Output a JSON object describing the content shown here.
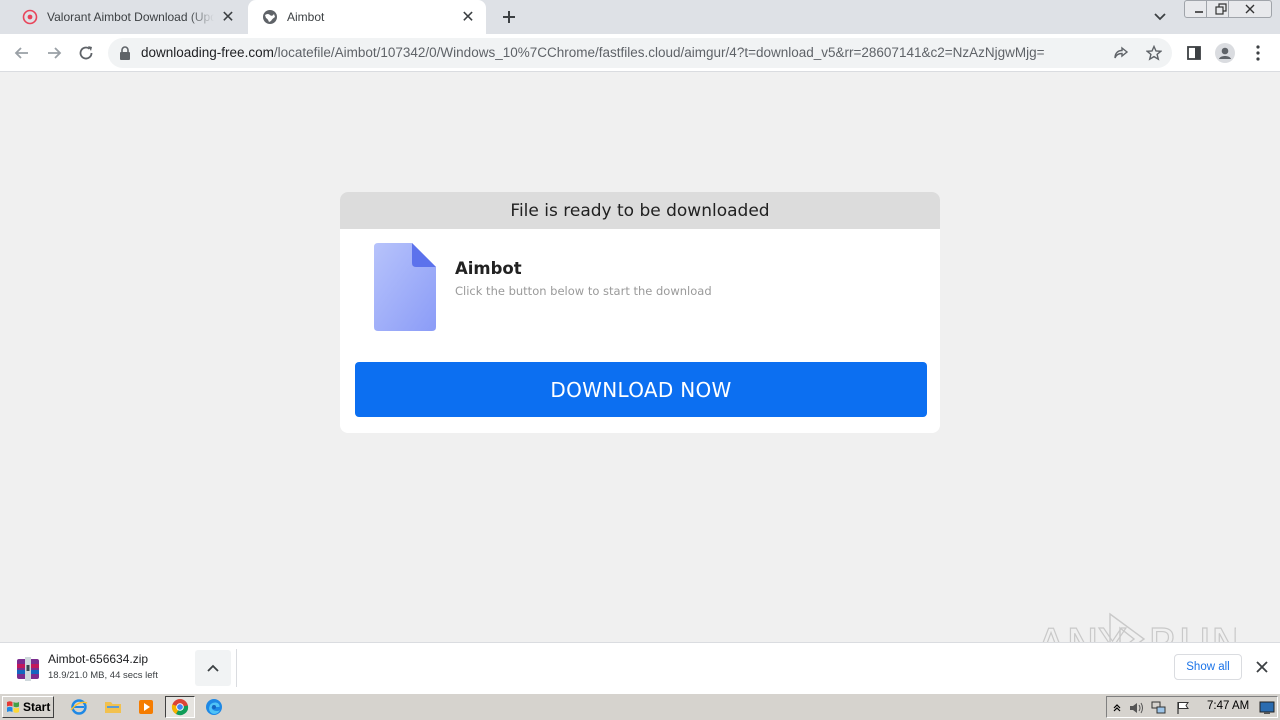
{
  "browser": {
    "tabs": [
      {
        "title": "Valorant Aimbot Download (Updated",
        "active": false
      },
      {
        "title": "Aimbot",
        "active": true
      }
    ],
    "url_host": "downloading-free.com",
    "url_path": "/locatefile/Aimbot/107342/0/Windows_10%7CChrome/fastfiles.cloud/aimgur/4?t=download_v5&rr=28607141&c2=NzAzNjgwMjg="
  },
  "page": {
    "header": "File is ready to be downloaded",
    "file_name": "Aimbot",
    "file_subtitle": "Click the button below to start the download",
    "download_button": "DOWNLOAD NOW",
    "colors": {
      "button": "#0c6ff1",
      "file_icon": "#8ea0f8"
    }
  },
  "download_shelf": {
    "file_name": "Aimbot-656634.zip",
    "status": "18.9/21.0 MB, 44 secs left",
    "show_all": "Show all"
  },
  "watermark": {
    "text": "ANY RUN"
  },
  "taskbar": {
    "start_label": "Start",
    "clock": "7:47 AM"
  }
}
